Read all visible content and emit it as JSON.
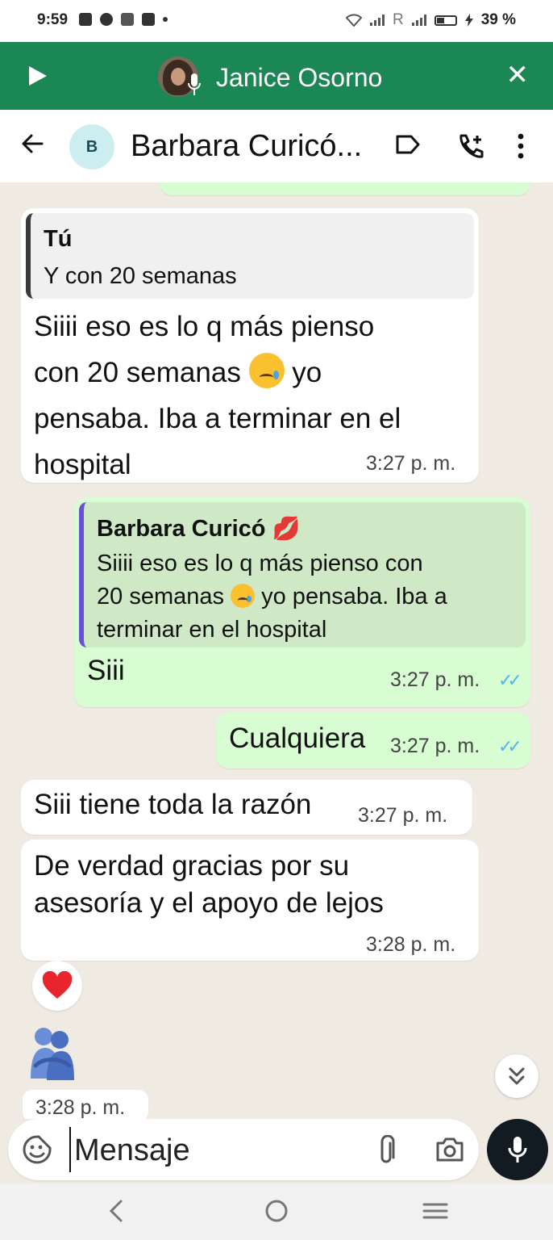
{
  "status_bar": {
    "time": "9:59",
    "carrier_mark": "R",
    "battery": "39 %",
    "battery_level": 0.39
  },
  "call_banner": {
    "caller_name": "Janice Osorno",
    "color": "#1b8755"
  },
  "chat_header": {
    "avatar_letter": "B",
    "contact_name": "Barbara Curicó..."
  },
  "messages": [
    {
      "direction": "in",
      "quote_author": "Tú",
      "quote_text": "Y con 20 semanas",
      "line1": "Siiii eso es lo q más pienso",
      "line2a": "con 20 semanas",
      "line2b": "yo",
      "line3": "pensaba. Iba a terminar en el",
      "line4": "hospital",
      "time": "3:27 p. m."
    },
    {
      "direction": "out",
      "quote_author": "Barbara Curicó",
      "quote_line1": "Siiii eso es lo q más pienso con",
      "quote_line2a": "20 semanas",
      "quote_line2b": "yo pensaba. Iba a",
      "quote_line3": "terminar en el hospital",
      "text": "Siii",
      "time": "3:27 p. m."
    },
    {
      "direction": "out",
      "text": "Cualquiera",
      "time": "3:27 p. m."
    },
    {
      "direction": "in",
      "text": "Siii tiene toda la razón",
      "time": "3:27 p. m."
    },
    {
      "direction": "in",
      "line1": "De verdad gracias por su",
      "line2": "asesoría y el apoyo de lejos",
      "time": "3:28 p. m."
    },
    {
      "direction": "in",
      "type": "sticker",
      "time": "3:28 p. m."
    }
  ],
  "composer": {
    "placeholder": "Mensaje"
  },
  "colors": {
    "incoming": "#ffffff",
    "outgoing": "#d9fdd3",
    "read_ticks": "#4fb6ec",
    "chat_bg": "#efeae2"
  },
  "icons": [
    "play-icon",
    "close-icon",
    "back-arrow-icon",
    "label-icon",
    "add-call-icon",
    "more-icon",
    "heart-reaction-icon",
    "hug-sticker-icon",
    "double-chevron-down-icon",
    "sticker-icon",
    "attach-icon",
    "camera-icon",
    "mic-icon",
    "nav-back-icon",
    "nav-home-icon",
    "nav-recents-icon"
  ]
}
